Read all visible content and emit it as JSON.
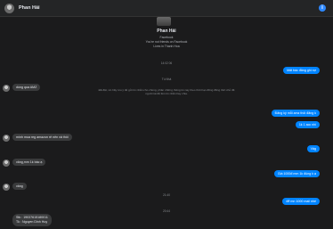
{
  "header": {
    "contact_name": "Phan Hải",
    "info_glyph": "i"
  },
  "profile": {
    "name": "Phan Hải",
    "source": "Facebook",
    "not_friends": "You're not friends on Facebook",
    "location": "Lives in Thanh Hoa"
  },
  "timestamps": [
    "14:02 06",
    "Tú Nhâ",
    "21:40",
    "20:44"
  ],
  "notice_text": "Đã đặt, xin hãy lưu ý để gửi tin nhắn cho chúng, phân những thông tin này theo thời hạn đồng đồng thời chủ đề người tài để liên tin nhắn hay chia.",
  "messages": [
    {
      "side": "out",
      "text": "Mất bác đăng ghi nợ"
    },
    {
      "side": "in",
      "text": "dùng qua AMZ"
    },
    {
      "side": "out",
      "text": "Đăng ký mỗi amz thôi đăng k"
    },
    {
      "side": "out",
      "text": "1k 1 acc nhi"
    },
    {
      "side": "in",
      "text": "mình mua reg amazon rẻ nên xả thôi"
    },
    {
      "side": "out",
      "text": "Vâg"
    },
    {
      "side": "in",
      "text": "vâng,mm 1k bác ạ"
    },
    {
      "side": "out",
      "text": "Giá 1000đ mm 1k đúng k ạ"
    },
    {
      "side": "in",
      "text": "vâng"
    },
    {
      "side": "out",
      "text": "để mn 1000 mail nhé"
    },
    {
      "side": "in",
      "lines": [
        "Stk : 19037615180011",
        "Tk : Nguyen Dinh Huy"
      ]
    }
  ]
}
